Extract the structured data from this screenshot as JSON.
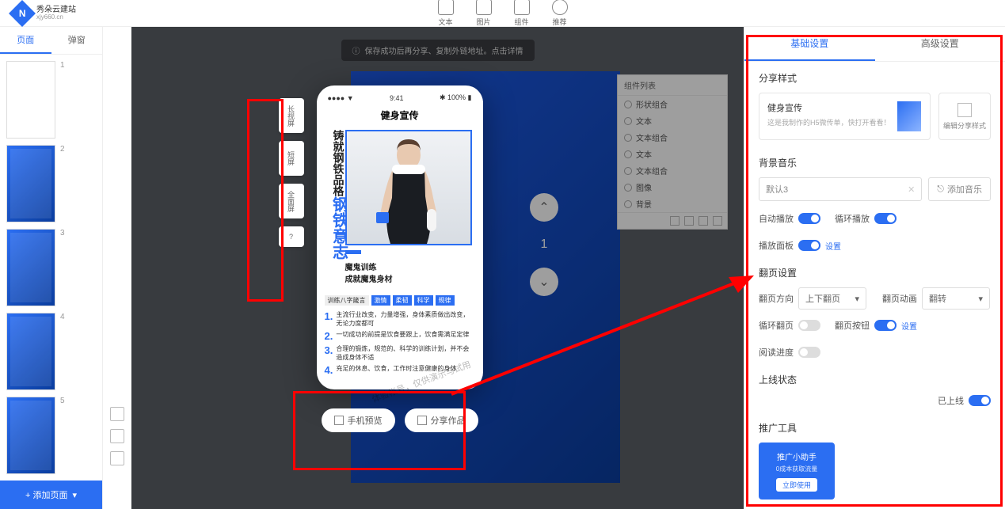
{
  "logo": {
    "letter": "N",
    "title": "秀朵云建站",
    "sub": "xjy660.cn"
  },
  "top_icons": [
    "文本",
    "图片",
    "组件",
    "推荐"
  ],
  "sidebar": {
    "tabs": [
      "页面",
      "弹窗"
    ],
    "add_page_label": "+ 添加页面",
    "thumbs": [
      "1",
      "2",
      "3",
      "4",
      "5"
    ]
  },
  "toast_msg": "保存成功后再分享、复制外链地址。点击详情",
  "phone": {
    "time": "9:41",
    "battery": "100%",
    "title": "健身宣传",
    "vert1": "铸就钢铁品格",
    "vert2": "钢铁意志",
    "caption1": "魔鬼训练",
    "caption2": "成就魔鬼身材",
    "tag_label": "训练八字箴言",
    "tags": [
      "激情",
      "柔韧",
      "科学",
      "规律"
    ],
    "list": [
      "主流行业改变，力量增强，身体素质做出改变，无论力度都可",
      "一切成功的前提是饮食要跟上，饮食需满足定律",
      "合理的锻炼，规范的、科学的训练计划，并不会造成身体不适",
      "充足的休息、饮食，工作时注意健康的身体"
    ]
  },
  "below_btns": [
    "手机预览",
    "分享作品"
  ],
  "left_float": [
    "长视屏",
    "短屏",
    "全面屏",
    "?"
  ],
  "page_nav_num": "1",
  "layers": {
    "title": "组件列表",
    "items": [
      "形状组合",
      "文本",
      "文本组合",
      "文本",
      "文本组合",
      "图像",
      "背景"
    ]
  },
  "rp": {
    "tabs": [
      "基础设置",
      "高级设置"
    ],
    "share": {
      "title": "分享样式",
      "card_title": "健身宣传",
      "card_sub": "这是我制作的H5微传单，快打开看看！",
      "edit_label": "编辑分享样式"
    },
    "music": {
      "title": "背景音乐",
      "selected": "默认3",
      "add_label": "添加音乐",
      "toggles": [
        [
          "自动播放",
          true
        ],
        [
          "循环播放",
          true
        ],
        [
          "播放面板",
          true
        ]
      ],
      "setting_link": "设置"
    },
    "pageset": {
      "title": "翻页设置",
      "dir_label": "翻页方向",
      "dir_value": "上下翻页",
      "anim_label": "翻页动画",
      "anim_value": "翻转",
      "row2": [
        [
          "循环翻页",
          false
        ],
        [
          "翻页按钮",
          true
        ]
      ],
      "setting_link": "设置",
      "speed_label": "阅读进度",
      "speed_on": false
    },
    "online": {
      "title": "上线状态",
      "status": "已上线"
    },
    "promo": {
      "title": "推广工具",
      "card_title": "推广小助手",
      "card_sub": "0成本获取流量",
      "action": "立即使用"
    }
  },
  "watermarks": [
    "体验帐号，仅供演示与试用",
    "仅供演示与试用"
  ]
}
